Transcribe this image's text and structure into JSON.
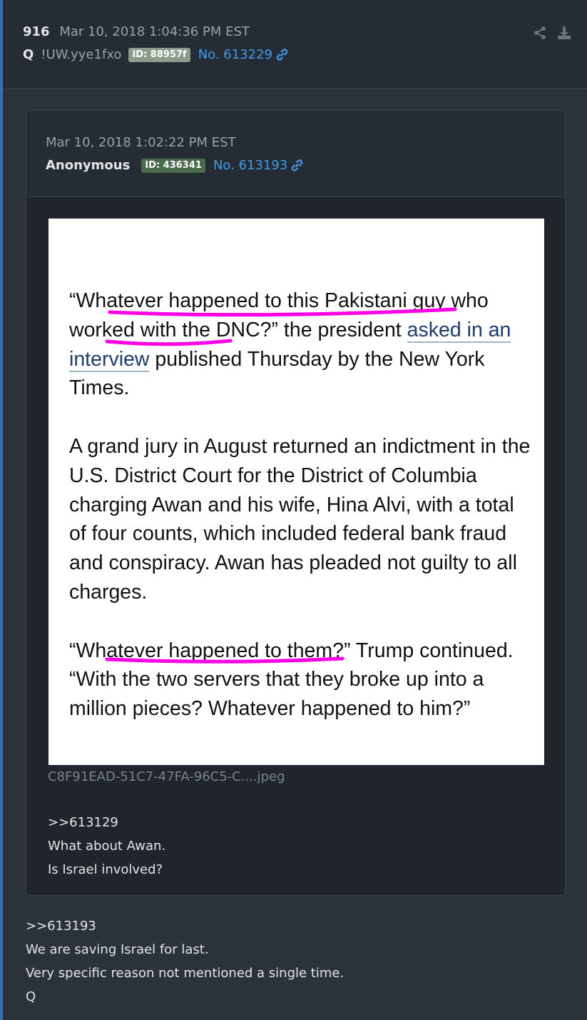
{
  "post": {
    "number": "916",
    "timestamp": "Mar 10, 2018 1:04:36 PM EST",
    "author": "Q",
    "tripcode": "!UW.yye1fxo",
    "id_badge": "ID: 88957f",
    "id_badge_color": "#8c9c8a",
    "post_link": "No. 613229",
    "body": [
      ">>613193",
      "We are saving Israel for last.",
      "Very specific reason not mentioned a single time.",
      "Q"
    ]
  },
  "quoted": {
    "timestamp": "Mar 10, 2018 1:02:22 PM EST",
    "author": "Anonymous",
    "id_badge": "ID: 436341",
    "id_badge_color": "#4b6b4d",
    "post_link": "No. 613193",
    "image": {
      "filename": "C8F91EAD-51C7-47FA-96C5-C....jpeg",
      "p1_before": "“Whatever happened to this Pakistani guy who worked with the DNC?” the president ",
      "p1_link": "asked in an interview",
      "p1_after": " published Thursday by the New York Times.",
      "p2": "A grand jury in August returned an indictment in the U.S. District Court for the District of Columbia charging Awan and his wife, Hina Alvi, with a total of four counts, which included federal bank fraud and conspiracy. Awan has pleaded not guilty to all charges.",
      "p3": "“Whatever happened to them?” Trump continued. “With the two servers that they broke up into a million pieces? Whatever happened to him?”",
      "highlight_color": "#ff00e6"
    },
    "body": [
      ">>613129",
      "What about Awan.",
      "Is Israel involved?"
    ]
  },
  "icons": {
    "share": "share-icon",
    "download": "download-icon",
    "link": "link-icon"
  },
  "colors": {
    "link": "#3d9be9",
    "accent_border": "#2f6fbd"
  }
}
